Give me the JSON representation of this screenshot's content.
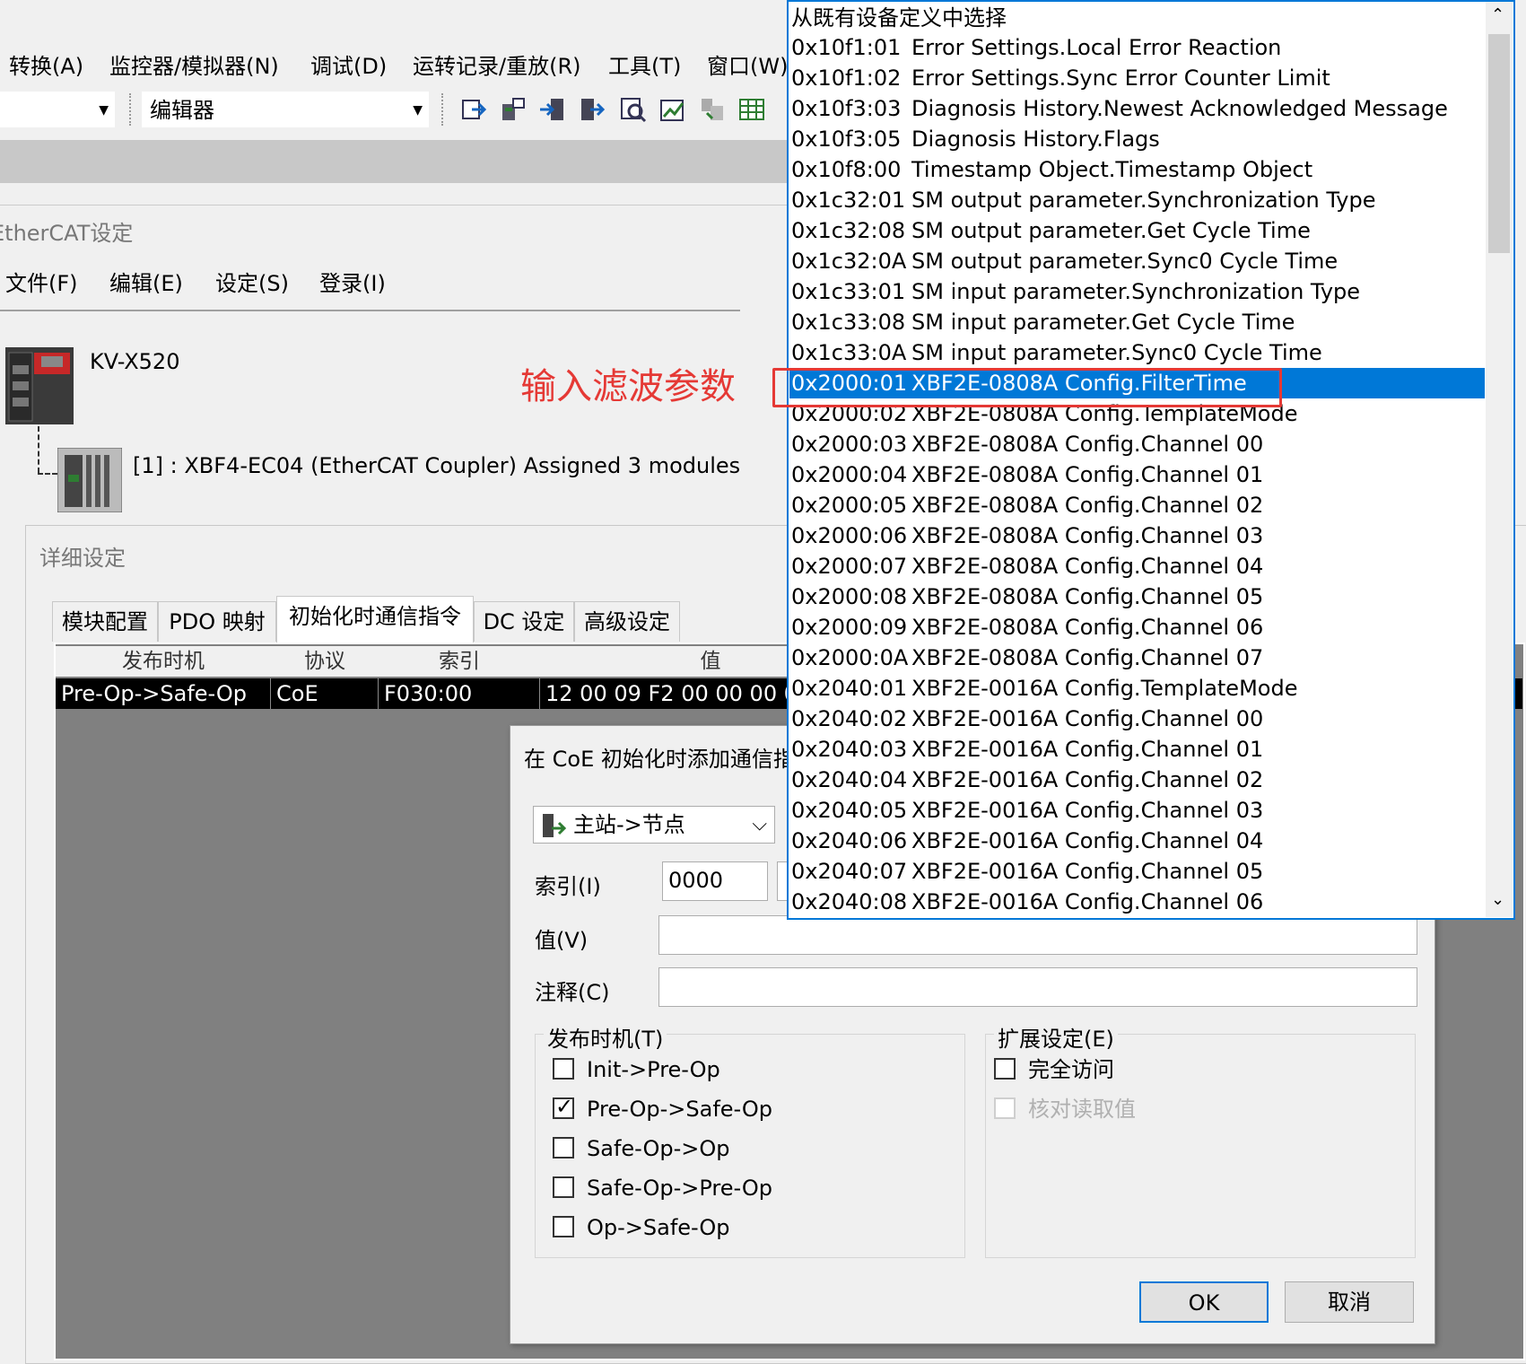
{
  "menubar": {
    "items": [
      "转换(A)",
      "监控器/模拟器(N)",
      "调试(D)",
      "运转记录/重放(R)",
      "工具(T)",
      "窗口(W)"
    ]
  },
  "toolbar": {
    "combo1_value": "",
    "combo2_value": "编辑器"
  },
  "ethercat_window": {
    "title": "EtherCAT设定",
    "menu": [
      "文件(F)",
      "编辑(E)",
      "设定(S)",
      "登录(I)"
    ],
    "tree": {
      "root": "KV-X520",
      "child": "[1] : XBF4-EC04 (EtherCAT Coupler) Assigned 3 modules"
    }
  },
  "detail_dialog": {
    "title": "详细设定",
    "tabs": [
      "模块配置",
      "PDO 映射",
      "初始化时通信指令",
      "DC 设定",
      "高级设定"
    ],
    "active_tab": 2,
    "columns": [
      "发布时机",
      "协议",
      "索引",
      "值"
    ],
    "row": [
      "Pre-Op->Safe-Op",
      "CoE",
      "F030:00",
      "12 00 09 F2 00 00 00 0"
    ]
  },
  "coe_dialog": {
    "title": "在 CoE 初始化时添加通信指令",
    "direction": "主站->节点",
    "index_label": "索引(I)",
    "index_value": "0000",
    "value_label": "值(V)",
    "value": "",
    "comment_label": "注释(C)",
    "comment": "",
    "timing_group": "发布时机(T)",
    "timing_options": [
      {
        "label": "Init->Pre-Op",
        "checked": false
      },
      {
        "label": "Pre-Op->Safe-Op",
        "checked": true
      },
      {
        "label": "Safe-Op->Op",
        "checked": false
      },
      {
        "label": "Safe-Op->Pre-Op",
        "checked": false
      },
      {
        "label": "Op->Safe-Op",
        "checked": false
      }
    ],
    "ext_group": "扩展设定(E)",
    "ext_options": [
      {
        "label": "完全访问",
        "checked": false,
        "enabled": true
      },
      {
        "label": "核对读取值",
        "checked": false,
        "enabled": false
      }
    ],
    "ok_label": "OK",
    "cancel_label": "取消"
  },
  "dropdown": {
    "header": "从既有设备定义中选择",
    "selected_index": 11,
    "items": [
      {
        "index": "0x10f1:01",
        "name": "Error Settings.Local Error Reaction"
      },
      {
        "index": "0x10f1:02",
        "name": "Error Settings.Sync Error Counter Limit"
      },
      {
        "index": "0x10f3:03",
        "name": "Diagnosis History.Newest Acknowledged Message"
      },
      {
        "index": "0x10f3:05",
        "name": "Diagnosis History.Flags"
      },
      {
        "index": "0x10f8:00",
        "name": "Timestamp Object.Timestamp Object"
      },
      {
        "index": "0x1c32:01",
        "name": "SM output parameter.Synchronization Type"
      },
      {
        "index": "0x1c32:08",
        "name": "SM output parameter.Get Cycle Time"
      },
      {
        "index": "0x1c32:0A",
        "name": "SM output parameter.Sync0 Cycle Time"
      },
      {
        "index": "0x1c33:01",
        "name": "SM input parameter.Synchronization Type"
      },
      {
        "index": "0x1c33:08",
        "name": "SM input parameter.Get Cycle Time"
      },
      {
        "index": "0x1c33:0A",
        "name": "SM input parameter.Sync0 Cycle Time"
      },
      {
        "index": "0x2000:01",
        "name": "XBF2E-0808A Config.FilterTime"
      },
      {
        "index": "0x2000:02",
        "name": "XBF2E-0808A Config.TemplateMode"
      },
      {
        "index": "0x2000:03",
        "name": "XBF2E-0808A Config.Channel 00"
      },
      {
        "index": "0x2000:04",
        "name": "XBF2E-0808A Config.Channel 01"
      },
      {
        "index": "0x2000:05",
        "name": "XBF2E-0808A Config.Channel 02"
      },
      {
        "index": "0x2000:06",
        "name": "XBF2E-0808A Config.Channel 03"
      },
      {
        "index": "0x2000:07",
        "name": "XBF2E-0808A Config.Channel 04"
      },
      {
        "index": "0x2000:08",
        "name": "XBF2E-0808A Config.Channel 05"
      },
      {
        "index": "0x2000:09",
        "name": "XBF2E-0808A Config.Channel 06"
      },
      {
        "index": "0x2000:0A",
        "name": "XBF2E-0808A Config.Channel 07"
      },
      {
        "index": "0x2040:01",
        "name": "XBF2E-0016A Config.TemplateMode"
      },
      {
        "index": "0x2040:02",
        "name": "XBF2E-0016A Config.Channel 00"
      },
      {
        "index": "0x2040:03",
        "name": "XBF2E-0016A Config.Channel 01"
      },
      {
        "index": "0x2040:04",
        "name": "XBF2E-0016A Config.Channel 02"
      },
      {
        "index": "0x2040:05",
        "name": "XBF2E-0016A Config.Channel 03"
      },
      {
        "index": "0x2040:06",
        "name": "XBF2E-0016A Config.Channel 04"
      },
      {
        "index": "0x2040:07",
        "name": "XBF2E-0016A Config.Channel 05"
      },
      {
        "index": "0x2040:08",
        "name": "XBF2E-0016A Config.Channel 06"
      }
    ]
  },
  "annotation": {
    "text": "输入滤波参数",
    "color": "#e53935"
  },
  "colors": {
    "accent": "#0078d7",
    "grid_background": "#808080"
  }
}
